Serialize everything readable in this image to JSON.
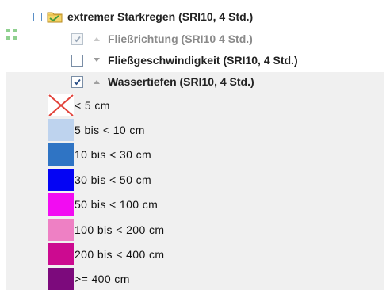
{
  "tree": {
    "group": {
      "label": "extremer Starkregen (SRI10, 4 Std.)",
      "expander_icon": "collapse-minus-icon",
      "folder_icon": "folder-icon"
    },
    "layers": [
      {
        "label": "Fließrichtung (SRI10 4 Std.)",
        "checked": true,
        "enabled": false,
        "arrow": "up"
      },
      {
        "label": "Fließgeschwindigkeit (SRI10, 4 Std.)",
        "checked": false,
        "enabled": true,
        "arrow": "down"
      },
      {
        "label": "Wassertiefen (SRI10, 4 Std.)",
        "checked": true,
        "enabled": true,
        "arrow": "up"
      }
    ]
  },
  "legend": {
    "items": [
      {
        "label": "< 5 cm",
        "color": "none",
        "icon": "no-fill-x-icon"
      },
      {
        "label": "5 bis < 10 cm",
        "color": "#bed3ee"
      },
      {
        "label": "10 bis < 30 cm",
        "color": "#2f74c4"
      },
      {
        "label": "30 bis < 50 cm",
        "color": "#0404f4"
      },
      {
        "label": "50 bis < 100 cm",
        "color": "#f20cf2"
      },
      {
        "label": "100 bis < 200 cm",
        "color": "#ee80c4"
      },
      {
        "label": "200 bis < 400 cm",
        "color": "#cc0a90"
      },
      {
        "label": ">= 400 cm",
        "color": "#7c0a7c"
      }
    ]
  }
}
